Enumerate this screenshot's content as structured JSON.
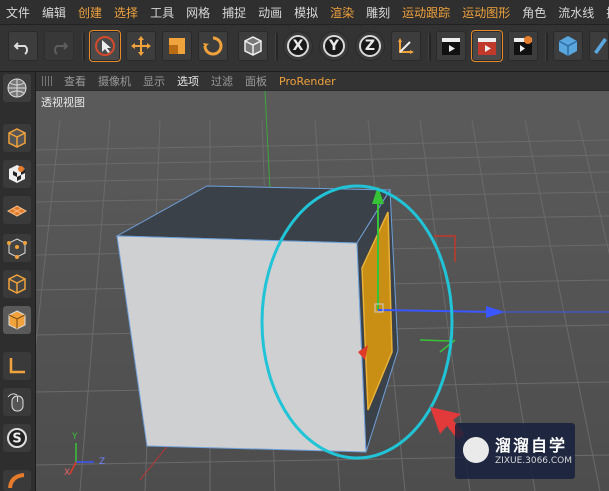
{
  "menu": {
    "items": [
      "文件",
      "编辑",
      "创建",
      "选择",
      "工具",
      "网格",
      "捕捉",
      "动画",
      "模拟",
      "渲染",
      "雕刻",
      "运动跟踪",
      "运动图形",
      "角色",
      "流水线",
      "插"
    ]
  },
  "toolbar": {
    "axis_x": "X",
    "axis_y": "Y",
    "axis_z": "Z"
  },
  "viewport_menu": {
    "items": [
      "查看",
      "摄像机",
      "显示",
      "选项",
      "过滤",
      "面板",
      "ProRender"
    ]
  },
  "viewport": {
    "label": "透视视图"
  },
  "axis_gizmo": {
    "y": "Y",
    "x": "X",
    "z": "Z"
  },
  "watermark": {
    "name": "溜溜自学",
    "url": "ZIXUE.3066.COM"
  },
  "colors": {
    "accent_orange": "#f0a23c",
    "selection_ellipse": "#21c4d6",
    "face_yellow": "#d9a21c"
  }
}
